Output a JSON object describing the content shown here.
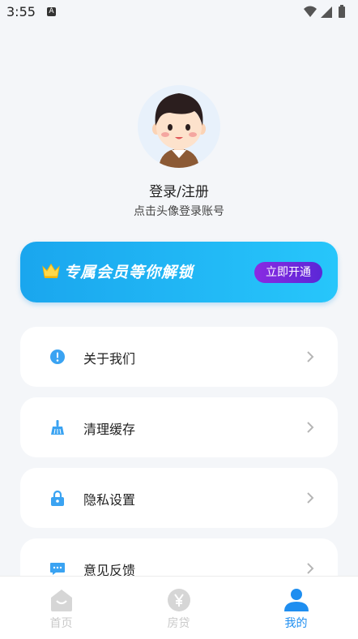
{
  "status_bar": {
    "time": "3:55",
    "notif_letter": "A"
  },
  "profile": {
    "title": "登录/注册",
    "subtitle": "点击头像登录账号"
  },
  "vip_banner": {
    "text": "专属会员等你解锁",
    "button_label": "立即开通"
  },
  "menu": [
    {
      "label": "关于我们",
      "icon": "info-icon"
    },
    {
      "label": "清理缓存",
      "icon": "broom-icon"
    },
    {
      "label": "隐私设置",
      "icon": "lock-icon"
    },
    {
      "label": "意见反馈",
      "icon": "chat-icon"
    }
  ],
  "tabs": [
    {
      "label": "首页",
      "icon": "home-icon",
      "active": false
    },
    {
      "label": "房贷",
      "icon": "yen-icon",
      "active": false
    },
    {
      "label": "我的",
      "icon": "user-icon",
      "active": true
    }
  ],
  "colors": {
    "accent": "#1e8ef0",
    "banner": "#1aa6ee",
    "button": "#7b2be0",
    "inactive_tab": "#c9c9c9"
  }
}
